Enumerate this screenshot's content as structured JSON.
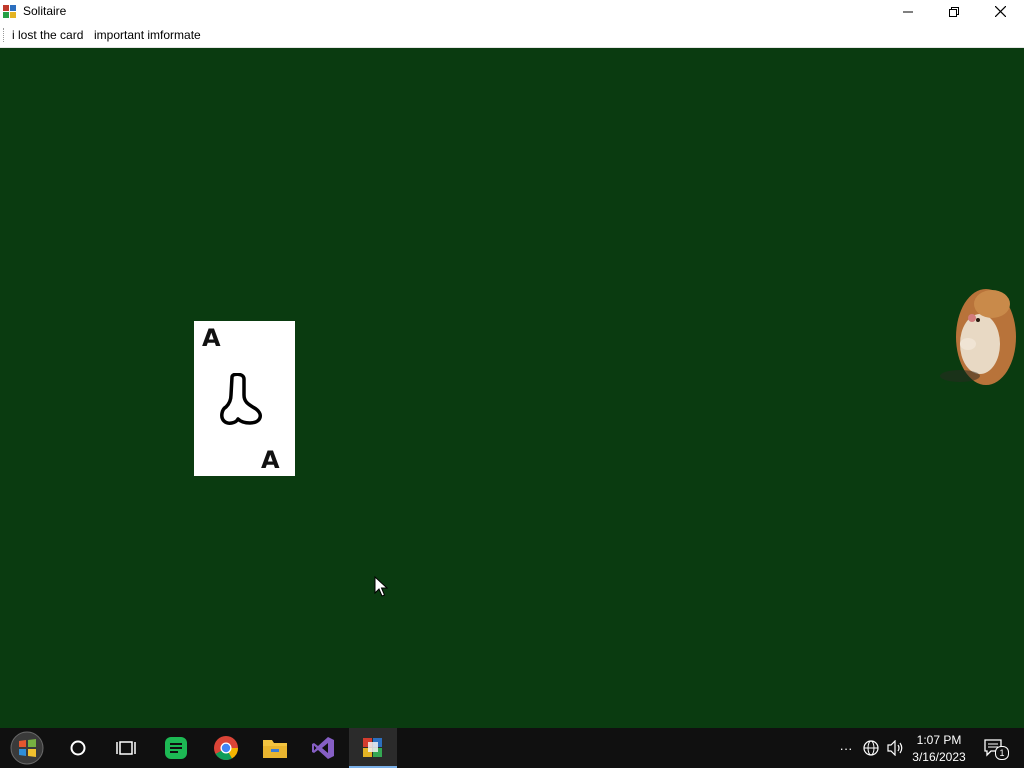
{
  "window": {
    "title": "Solitaire",
    "controls": [
      "minimize",
      "restore",
      "close"
    ]
  },
  "menu": {
    "items": [
      {
        "label": "i lost the card"
      },
      {
        "label": "important imformate"
      }
    ]
  },
  "game": {
    "background_color": "#0a3b10",
    "card": {
      "rank_top": "A",
      "rank_bottom": "A",
      "suit_drawing": "hand-drawn-shape"
    },
    "decoration": "hamster-image"
  },
  "taskbar": {
    "apps": [
      {
        "name": "start-button-icon"
      },
      {
        "name": "search-icon"
      },
      {
        "name": "task-view-icon"
      },
      {
        "name": "messages-app-icon"
      },
      {
        "name": "chrome-icon"
      },
      {
        "name": "file-explorer-icon"
      },
      {
        "name": "visual-studio-icon"
      },
      {
        "name": "solitaire-app-icon",
        "active": true
      }
    ],
    "tray": {
      "overflow": "···",
      "time": "1:07 PM",
      "date": "3/16/2023",
      "notification_count": "1"
    }
  },
  "colors": {
    "felt": "#0a3b10",
    "taskbar": "#101010",
    "accent": "#7ab0e8"
  }
}
